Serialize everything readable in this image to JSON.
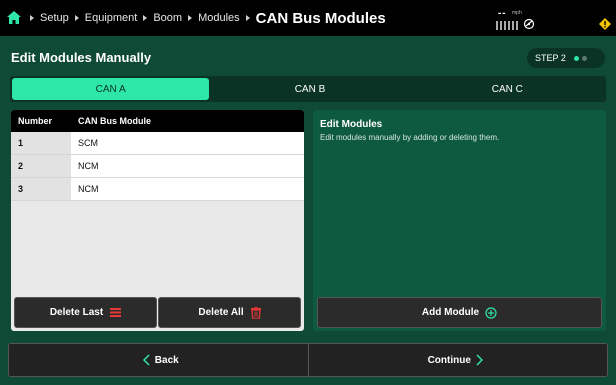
{
  "topbar": {
    "breadcrumbs": [
      "Setup",
      "Equipment",
      "Boom",
      "Modules"
    ],
    "current": "CAN Bus Modules",
    "speed_value": "- -",
    "speed_unit": "mph"
  },
  "header": {
    "title": "Edit Modules Manually",
    "step_label": "STEP 2"
  },
  "tabs": [
    {
      "label": "CAN A",
      "active": true
    },
    {
      "label": "CAN B",
      "active": false
    },
    {
      "label": "CAN C",
      "active": false
    }
  ],
  "table": {
    "columns": [
      "Number",
      "CAN Bus Module"
    ],
    "rows": [
      {
        "number": "1",
        "module": "SCM"
      },
      {
        "number": "2",
        "module": "NCM"
      },
      {
        "number": "3",
        "module": "NCM"
      }
    ]
  },
  "left_buttons": {
    "delete_last": "Delete Last",
    "delete_all": "Delete All"
  },
  "right_panel": {
    "title": "Edit Modules",
    "description": "Edit modules manually by adding or deleting them.",
    "add_button": "Add Module"
  },
  "footer": {
    "back": "Back",
    "continue": "Continue"
  },
  "colors": {
    "background": "#0f4a36",
    "accent": "#2ee6a7",
    "delete_icon": "#e53935"
  },
  "icons": [
    "home-icon",
    "gps-icon",
    "warning-icon",
    "list-delete-icon",
    "trash-icon",
    "plus-circle-icon",
    "chevron-left-icon",
    "chevron-right-icon"
  ]
}
